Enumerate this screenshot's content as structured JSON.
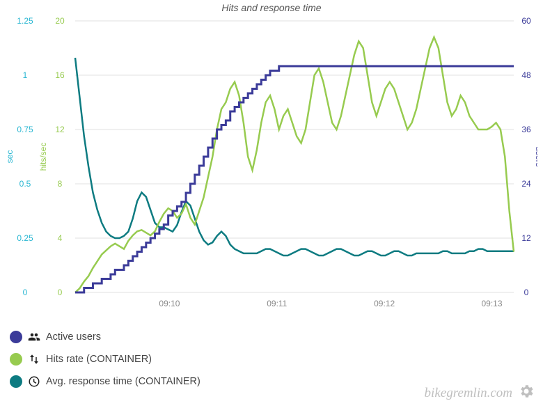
{
  "chart_data": {
    "type": "line",
    "title": "Hits and response time",
    "x_ticks": [
      "09:10",
      "09:11",
      "09:12",
      "09:13"
    ],
    "x_range_index": [
      0,
      100
    ],
    "axes": {
      "sec": {
        "label": "sec",
        "color": "#2ab7d2",
        "side": "left-outer",
        "range": [
          0,
          1.25
        ],
        "ticks": [
          0,
          0.25,
          0.5,
          0.75,
          1,
          1.25
        ]
      },
      "hits": {
        "label": "hits/sec",
        "color": "#97cb4f",
        "side": "left-inner",
        "range": [
          0,
          20
        ],
        "ticks": [
          0,
          4,
          8,
          12,
          16,
          20
        ]
      },
      "users": {
        "label": "users",
        "color": "#3b3b99",
        "side": "right",
        "range": [
          0,
          60
        ],
        "ticks": [
          0,
          12,
          24,
          36,
          48,
          60
        ]
      }
    },
    "series": [
      {
        "name": "Active users",
        "axis": "users",
        "color": "#3b3b99",
        "values": [
          0,
          0,
          1,
          1,
          2,
          2,
          3,
          3,
          4,
          5,
          5,
          6,
          7,
          8,
          9,
          10,
          11,
          12,
          13,
          14,
          15,
          17,
          18,
          19,
          20,
          22,
          24,
          26,
          28,
          30,
          32,
          34,
          36,
          37,
          38,
          40,
          41,
          42,
          43,
          44,
          45,
          46,
          47,
          48,
          49,
          49,
          50,
          50,
          50,
          50,
          50,
          50,
          50,
          50,
          50,
          50,
          50,
          50,
          50,
          50,
          50,
          50,
          50,
          50,
          50,
          50,
          50,
          50,
          50,
          50,
          50,
          50,
          50,
          50,
          50,
          50,
          50,
          50,
          50,
          50,
          50,
          50,
          50,
          50,
          50,
          50,
          50,
          50,
          50,
          50,
          50,
          50,
          50,
          50,
          50,
          50,
          50,
          50,
          50,
          50
        ]
      },
      {
        "name": "Hits rate (CONTAINER)",
        "axis": "hits",
        "color": "#97cb4f",
        "values": [
          0.0,
          0.3,
          0.8,
          1.2,
          1.8,
          2.3,
          2.8,
          3.1,
          3.4,
          3.6,
          3.4,
          3.2,
          3.8,
          4.2,
          4.5,
          4.6,
          4.4,
          4.2,
          4.5,
          5.2,
          5.8,
          6.2,
          6.0,
          5.5,
          5.8,
          6.5,
          5.5,
          5.0,
          6.0,
          7.0,
          8.5,
          10.0,
          12.0,
          13.5,
          14.0,
          15.0,
          15.5,
          14.5,
          12.5,
          10.0,
          9.0,
          10.5,
          12.5,
          14.0,
          14.5,
          13.5,
          12.0,
          13.0,
          13.5,
          12.5,
          11.5,
          11.0,
          12.0,
          14.0,
          16.0,
          16.5,
          15.5,
          14.0,
          12.5,
          12.0,
          13.0,
          14.5,
          16.0,
          17.5,
          18.5,
          18.0,
          16.0,
          14.0,
          13.0,
          14.0,
          15.0,
          15.5,
          15.0,
          14.0,
          13.0,
          12.0,
          12.5,
          13.5,
          15.0,
          16.5,
          18.0,
          18.8,
          18.0,
          16.0,
          14.0,
          13.0,
          13.5,
          14.5,
          14.0,
          13.0,
          12.5,
          12.0,
          12.0,
          12.0,
          12.2,
          12.5,
          12.0,
          10.0,
          6.0,
          3.0
        ]
      },
      {
        "name": "Avg. response time (CONTAINER)",
        "axis": "sec",
        "color": "#0d7b81",
        "values": [
          1.08,
          0.9,
          0.72,
          0.58,
          0.46,
          0.38,
          0.32,
          0.28,
          0.26,
          0.25,
          0.25,
          0.26,
          0.28,
          0.34,
          0.42,
          0.46,
          0.44,
          0.38,
          0.32,
          0.3,
          0.3,
          0.29,
          0.28,
          0.31,
          0.37,
          0.42,
          0.4,
          0.34,
          0.28,
          0.24,
          0.22,
          0.23,
          0.26,
          0.28,
          0.26,
          0.22,
          0.2,
          0.19,
          0.18,
          0.18,
          0.18,
          0.18,
          0.19,
          0.2,
          0.2,
          0.19,
          0.18,
          0.17,
          0.17,
          0.18,
          0.19,
          0.2,
          0.2,
          0.19,
          0.18,
          0.17,
          0.17,
          0.18,
          0.19,
          0.2,
          0.2,
          0.19,
          0.18,
          0.17,
          0.17,
          0.18,
          0.19,
          0.19,
          0.18,
          0.17,
          0.17,
          0.18,
          0.19,
          0.19,
          0.18,
          0.17,
          0.17,
          0.18,
          0.18,
          0.18,
          0.18,
          0.18,
          0.18,
          0.19,
          0.19,
          0.18,
          0.18,
          0.18,
          0.18,
          0.19,
          0.19,
          0.2,
          0.2,
          0.19,
          0.19,
          0.19,
          0.19,
          0.19,
          0.19,
          0.19
        ]
      }
    ]
  },
  "legend": {
    "items": [
      {
        "label": "Active users"
      },
      {
        "label": "Hits rate (CONTAINER)"
      },
      {
        "label": "Avg. response time (CONTAINER)"
      }
    ]
  },
  "watermark": {
    "text": "bikegremlin.com"
  }
}
